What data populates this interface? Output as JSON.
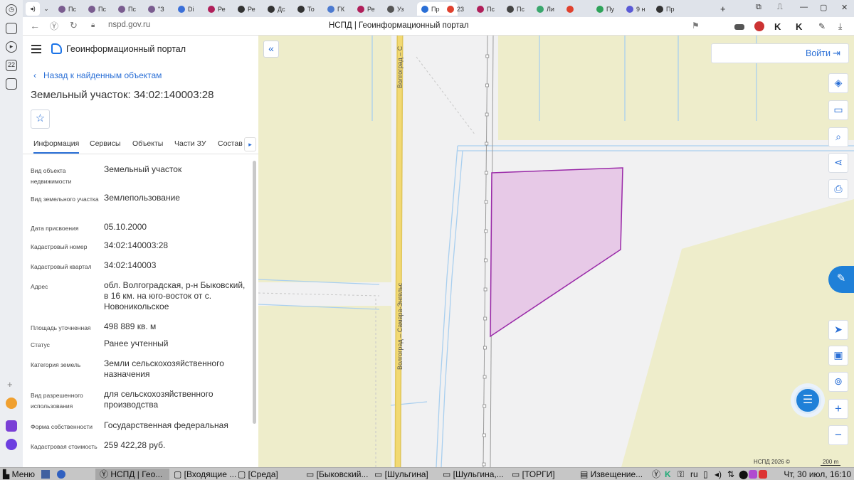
{
  "browser": {
    "tabs": [
      {
        "label": "Пс",
        "color": "#7a5c8f"
      },
      {
        "label": "Пс",
        "color": "#7a5c8f"
      },
      {
        "label": "Пс",
        "color": "#7a5c8f"
      },
      {
        "label": "\"З",
        "color": "#7a5c8f"
      },
      {
        "label": "Di",
        "color": "#3a6fd8"
      },
      {
        "label": "Ре",
        "color": "#b01f5a"
      },
      {
        "label": "Ре",
        "color": "#333333"
      },
      {
        "label": "Дс",
        "color": "#333333"
      },
      {
        "label": "То",
        "color": "#333333"
      },
      {
        "label": "ГК",
        "color": "#4c7ad0"
      },
      {
        "label": "Ре",
        "color": "#b01f5a"
      },
      {
        "label": "Уз",
        "color": "#555555"
      },
      {
        "label": "Пр",
        "color": "#2a6fd6"
      },
      {
        "label": "23",
        "color": "#e0412e"
      },
      {
        "label": "Пс",
        "color": "#b01f5a"
      },
      {
        "label": "Пс",
        "color": "#444444"
      },
      {
        "label": "Ли",
        "color": "#3aa76d"
      },
      {
        "label": "",
        "color": "#e0412e"
      },
      {
        "label": "Пу",
        "color": "#2fa35a"
      },
      {
        "label": "9 н",
        "color": "#5a5ad6"
      },
      {
        "label": "Пр",
        "color": "#333333"
      }
    ],
    "url": "nspd.gov.ru",
    "page_title": "НСПД | Геоинформационный портал"
  },
  "panel": {
    "brand": "Геоинформационный портал",
    "back_link": "Назад к найденным объектам",
    "title": "Земельный участок: 34:02:140003:28",
    "tabs": [
      "Информация",
      "Сервисы",
      "Объекты",
      "Части ЗУ",
      "Состав"
    ],
    "fields": [
      {
        "label": "Вид объекта недвижимости",
        "value": "Земельный участок"
      },
      {
        "label": "Вид земельного участка",
        "value": "Землепользование"
      },
      {
        "label": "Дата присвоения",
        "value": "05.10.2000"
      },
      {
        "label": "Кадастровый номер",
        "value": "34:02:140003:28"
      },
      {
        "label": "Кадастровый квартал",
        "value": "34:02:140003"
      },
      {
        "label": "Адрес",
        "value": "обл. Волгоградская, р-н Быковский, в 16 км. на юго-восток от с. Новоникольское"
      },
      {
        "label": "Площадь уточненная",
        "value": "498 889 кв. м"
      },
      {
        "label": "Статус",
        "value": "Ранее учтенный"
      },
      {
        "label": "Категория земель",
        "value": "Земли сельскохозяйственного назначения"
      },
      {
        "label": "Вид разрешенного использования",
        "value": "для сельскохозяйственного производства"
      },
      {
        "label": "Форма собственности",
        "value": "Государственная федеральная"
      },
      {
        "label": "Кадастровая стоимость",
        "value": "259 422,28 руб."
      }
    ]
  },
  "map": {
    "login_label": "Войти",
    "road_label_top": "Волгоград – С",
    "road_label_bottom": "Волгоград – Самара-Энгельс",
    "attribution": "НСПД 2026 ©",
    "scale": "200 m",
    "parcel_color": "#e6c4e6",
    "parcel_stroke": "#9a2aa8"
  },
  "taskbar": {
    "menu": "Меню",
    "items": [
      "НСПД | Гео...",
      "[Входящие ...",
      "[Среда]",
      "[Быковский...",
      "[Шульгина]",
      "[Шульгина,...",
      "[ТОРГИ]",
      "Извещение..."
    ],
    "lang": "ru",
    "clock": "Чт, 30 июл, 16:10"
  }
}
